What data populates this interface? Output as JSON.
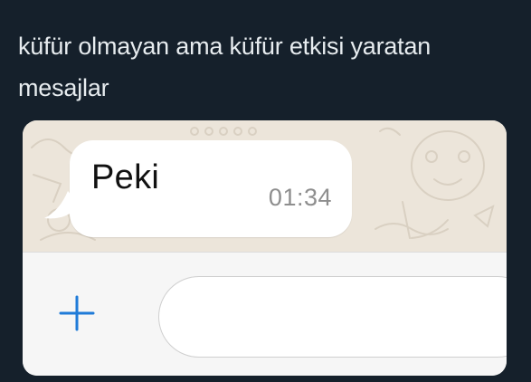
{
  "post": {
    "text": "küfür olmayan ama küfür etkisi yaratan mesajlar"
  },
  "chat": {
    "message": {
      "text": "Peki",
      "time": "01:34"
    },
    "input": {
      "plus_icon": "plus-icon",
      "placeholder": ""
    }
  },
  "colors": {
    "page_background": "#15202b",
    "chat_wallpaper": "#ece5da",
    "bubble": "#ffffff",
    "plus_icon": "#1f7bd8"
  }
}
